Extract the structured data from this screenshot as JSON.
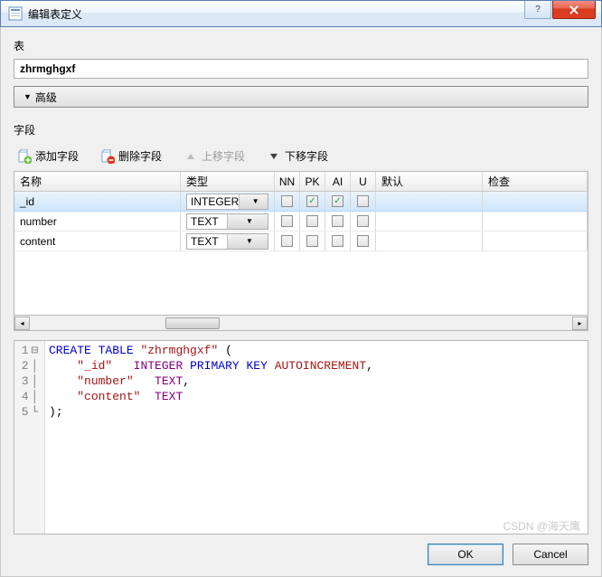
{
  "window": {
    "title": "编辑表定义",
    "faded_suffix": ""
  },
  "section_table": {
    "label": "表",
    "value": "zhrmghgxf",
    "advanced_btn": "高级"
  },
  "section_fields": {
    "label": "字段",
    "toolbar": {
      "add": "添加字段",
      "delete": "删除字段",
      "move_up": "上移字段",
      "move_down": "下移字段"
    },
    "headers": {
      "name": "名称",
      "type": "类型",
      "nn": "NN",
      "pk": "PK",
      "ai": "AI",
      "u": "U",
      "def": "默认",
      "chk": "检查"
    },
    "rows": [
      {
        "name": "_id",
        "type": "INTEGER",
        "nn": false,
        "pk": true,
        "ai": true,
        "u": false,
        "def": "",
        "chk": "",
        "selected": true
      },
      {
        "name": "number",
        "type": "TEXT",
        "nn": false,
        "pk": false,
        "ai": false,
        "u": false,
        "def": "",
        "chk": "",
        "selected": false
      },
      {
        "name": "content",
        "type": "TEXT",
        "nn": false,
        "pk": false,
        "ai": false,
        "u": false,
        "def": "",
        "chk": "",
        "selected": false
      }
    ]
  },
  "sql": {
    "line_count": 5,
    "tokens": {
      "create": "CREATE",
      "table": "TABLE",
      "tname": "\"zhrmghgxf\"",
      "op_open": " (",
      "c1q": "\"_id\"",
      "c1t": "INTEGER",
      "c1p": "PRIMARY",
      "c1k": "KEY",
      "c1a": "AUTOINCREMENT",
      "c2q": "\"number\"",
      "c2t": "TEXT",
      "c3q": "\"content\"",
      "c3t": "TEXT",
      "close": ");"
    }
  },
  "buttons": {
    "ok": "OK",
    "cancel": "Cancel"
  },
  "watermark": "CSDN @海天鹰"
}
